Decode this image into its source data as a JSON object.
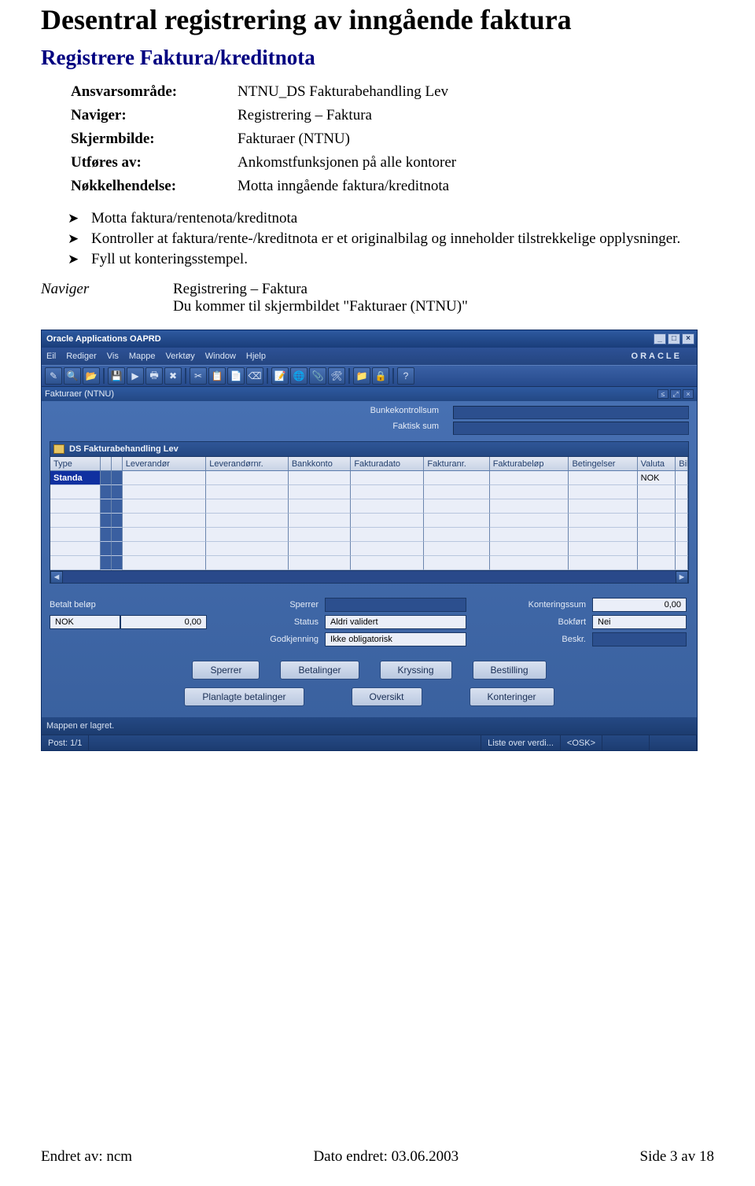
{
  "doc": {
    "title": "Desentral registrering av inngående faktura",
    "subtitle": "Registrere Faktura/kreditnota",
    "meta": {
      "labels": {
        "ansvar": "Ansvarsområde:",
        "naviger": "Naviger:",
        "skjerm": "Skjermbilde:",
        "utfores": "Utføres av:",
        "nokkel": "Nøkkelhendelse:"
      },
      "ansvar_val": "NTNU_DS Fakturabehandling Lev",
      "naviger_val": "Registrering – Faktura",
      "skjerm_val": "Fakturaer (NTNU)",
      "utfores_val": "Ankomstfunksjonen på alle kontorer",
      "nokkel_val": "Motta inngående faktura/kreditnota"
    },
    "bullets": [
      "Motta faktura/rentenota/kreditnota",
      "Kontroller at faktura/rente-/kreditnota er et originalbilag og inneholder tilstrekkelige opplysninger.",
      "Fyll ut konteringsstempel."
    ],
    "naviger_label": "Naviger",
    "naviger_body1": "Registrering – Faktura",
    "naviger_body2": "Du kommer til skjermbildet \"Fakturaer (NTNU)\""
  },
  "app": {
    "window_title": "Oracle Applications OAPRD",
    "menu": [
      "Eil",
      "Rediger",
      "Vis",
      "Mappe",
      "Verktøy",
      "Window",
      "Hjelp"
    ],
    "brand": "ORACLE",
    "sub_title": "Fakturaer (NTNU)",
    "labels": {
      "bunkekontroll": "Bunkekontrollsum",
      "faktisk": "Faktisk sum"
    },
    "folder_name": "DS Fakturabehandling Lev",
    "columns": {
      "type": "Type",
      "lev": "Leverandør",
      "levn": "Leverandørnr.",
      "bank": "Bankkonto",
      "fdat": "Fakturadato",
      "fnr": "Fakturanr.",
      "fbel": "Fakturabeløp",
      "bet": "Betingelser",
      "val": "Valuta",
      "bil": "Bil"
    },
    "row0": {
      "type": "Standa",
      "valuta": "NOK"
    },
    "summary": {
      "betalt_lbl": "Betalt beløp",
      "betalt_curr": "NOK",
      "betalt_amt": "0,00",
      "sperrer": "Sperrer",
      "status_lbl": "Status",
      "status_val": "Aldri validert",
      "godkj_lbl": "Godkjenning",
      "godkj_val": "Ikke obligatorisk",
      "ksum_lbl": "Konteringssum",
      "ksum_val": "0,00",
      "bokfort_lbl": "Bokført",
      "bokfort_val": "Nei",
      "beskr_lbl": "Beskr."
    },
    "buttons": {
      "sperrer": "Sperrer",
      "betalinger": "Betalinger",
      "kryssing": "Kryssing",
      "bestilling": "Bestilling",
      "planlagte": "Planlagte betalinger",
      "oversikt": "Oversikt",
      "konteringer": "Konteringer"
    },
    "status1": "Mappen er lagret.",
    "status2_left": "Post: 1/1",
    "status2_mid": "Liste over verdi...",
    "status2_osk": "<OSK>"
  },
  "footer": {
    "left": "Endret av: ncm",
    "center": "Dato endret: 03.06.2003",
    "right": "Side 3 av 18"
  }
}
